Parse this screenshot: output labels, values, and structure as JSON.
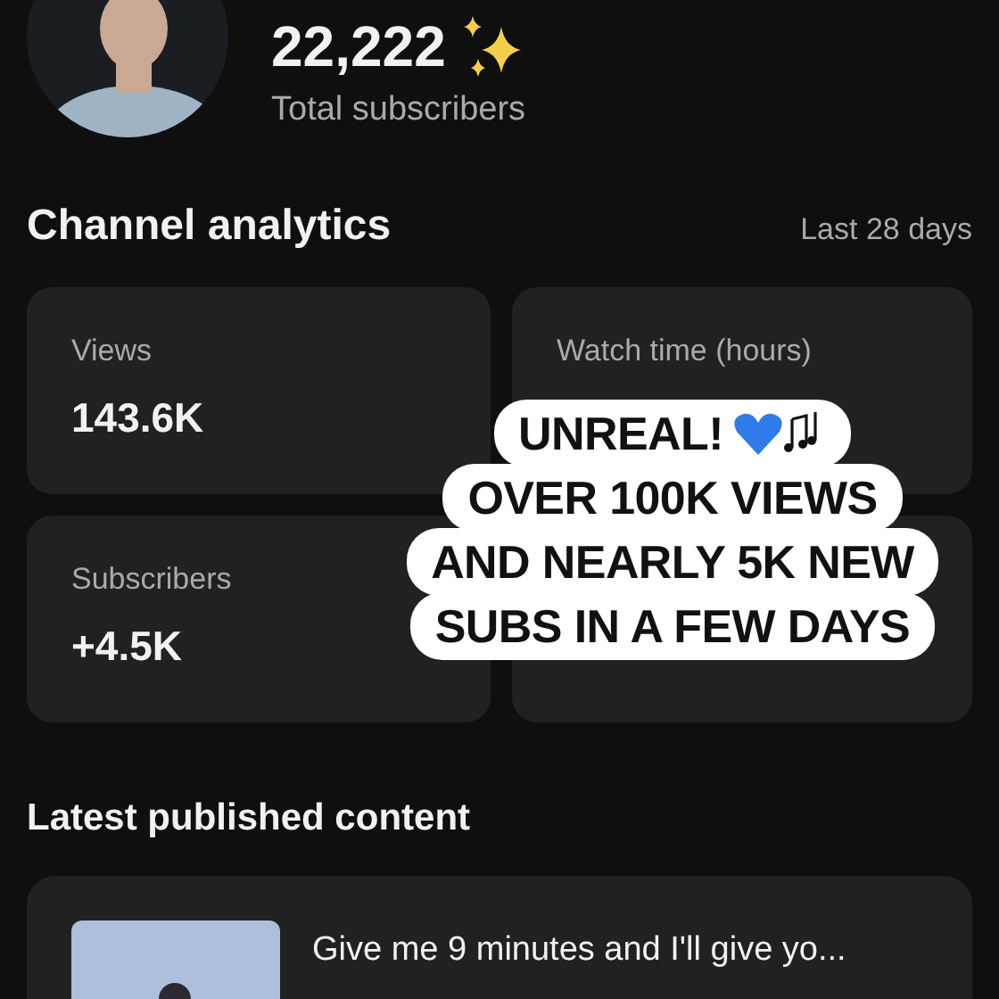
{
  "profile": {
    "subscriber_count": "22,222",
    "subscriber_label": "Total subscribers"
  },
  "analytics": {
    "title": "Channel analytics",
    "period": "Last 28 days",
    "cards": [
      {
        "kind": "metric",
        "label": "Views",
        "value": "143.6K"
      },
      {
        "kind": "metric",
        "label": "Watch time (hours)"
      },
      {
        "kind": "metric",
        "label": "Subscribers",
        "value": "+4.5K"
      },
      {
        "kind": "metric"
      }
    ]
  },
  "caption": {
    "lines": [
      "UNREAL!",
      "OVER 100K VIEWS",
      "AND NEARLY 5K NEW",
      "SUBS IN A FEW DAYS"
    ]
  },
  "latest": {
    "title": "Latest published content",
    "items": [
      {
        "title": "Give me 9 minutes and I'll give yo..."
      }
    ]
  }
}
